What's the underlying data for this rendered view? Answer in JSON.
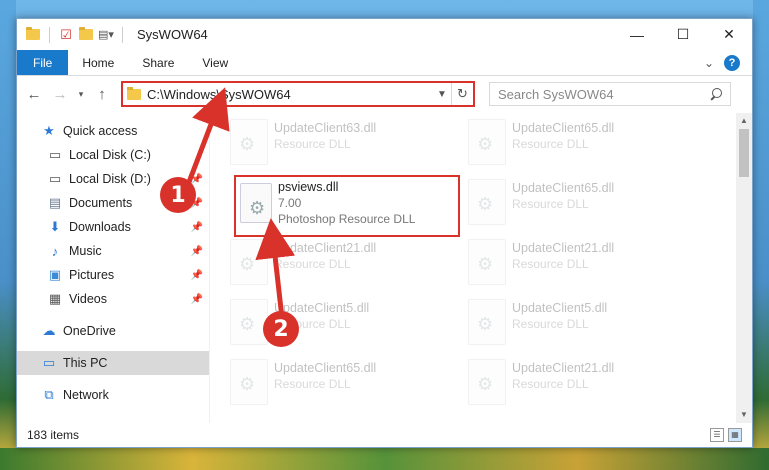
{
  "window": {
    "title": "SysWOW64",
    "controls": {
      "minimize": "—",
      "maximize": "☐",
      "close": "✕"
    }
  },
  "ribbon": {
    "tabs": [
      "File",
      "Home",
      "Share",
      "View"
    ]
  },
  "address": {
    "path": "C:\\Windows\\SysWOW64",
    "search_placeholder": "Search SysWOW64"
  },
  "nav": {
    "quick_access": "Quick access",
    "items": [
      {
        "label": "Local Disk (C:)",
        "icon": "drive-icon",
        "pinned": false
      },
      {
        "label": "Local Disk (D:)",
        "icon": "drive-icon",
        "pinned": true
      },
      {
        "label": "Documents",
        "icon": "documents-icon",
        "pinned": true
      },
      {
        "label": "Downloads",
        "icon": "downloads-icon",
        "pinned": true
      },
      {
        "label": "Music",
        "icon": "music-icon",
        "pinned": true
      },
      {
        "label": "Pictures",
        "icon": "pictures-icon",
        "pinned": true
      },
      {
        "label": "Videos",
        "icon": "videos-icon",
        "pinned": true
      }
    ],
    "onedrive": "OneDrive",
    "this_pc": "This PC",
    "network": "Network"
  },
  "files": [
    {
      "name": "UpdateClient63.dll",
      "type": "Resource DLL",
      "faded": true
    },
    {
      "name": "UpdateClient65.dll",
      "type": "Resource DLL",
      "faded": true
    },
    {
      "name": "psviews.dll",
      "version": "7.00",
      "type": "Photoshop Resource DLL",
      "faded": false,
      "highlighted": true
    },
    {
      "name": "UpdateClient65.dll",
      "type": "Resource DLL",
      "faded": true
    },
    {
      "name": "UpdateClient21.dll",
      "type": "Resource DLL",
      "faded": true
    },
    {
      "name": "UpdateClient21.dll",
      "type": "Resource DLL",
      "faded": true
    },
    {
      "name": "UpdateClient5.dll",
      "type": "Resource DLL",
      "faded": true
    },
    {
      "name": "UpdateClient5.dll",
      "type": "Resource DLL",
      "faded": true
    },
    {
      "name": "UpdateClient65.dll",
      "type": "Resource DLL",
      "faded": true
    },
    {
      "name": "UpdateClient21.dll",
      "type": "Resource DLL",
      "faded": true
    }
  ],
  "status": {
    "count": "183 items"
  },
  "annotations": {
    "marker1": "1",
    "marker2": "2",
    "color": "#d8322a"
  }
}
